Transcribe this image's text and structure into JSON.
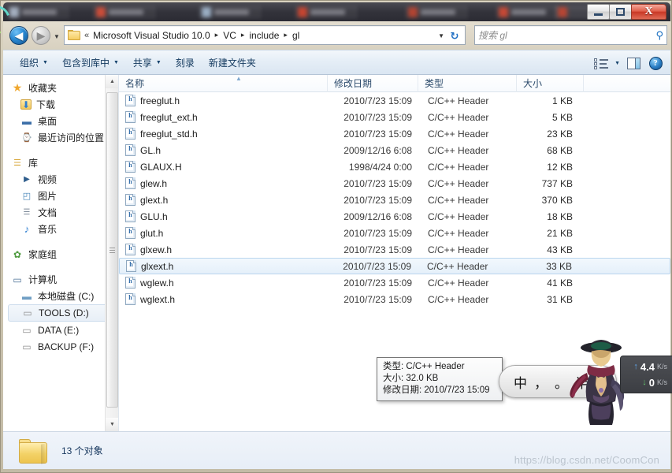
{
  "window": {
    "controls": {
      "minimize": "—",
      "maximize": "□",
      "close": "X"
    },
    "taskbar_chips": 7
  },
  "address": {
    "back_glyph": "◀",
    "forward_glyph": "▶",
    "history_caret": "▼",
    "chevrons": "«",
    "crumbs": [
      "Microsoft Visual Studio 10.0",
      "VC",
      "include",
      "gl"
    ],
    "separator": "▸",
    "dropdown_caret": "▼",
    "refresh_glyph": "↻",
    "search_placeholder": "搜索 gl",
    "search_icon_glyph": "⚲"
  },
  "toolbar": {
    "items": [
      {
        "label": "组织",
        "caret": true
      },
      {
        "label": "包含到库中",
        "caret": true
      },
      {
        "label": "共享",
        "caret": true
      },
      {
        "label": "刻录",
        "caret": false
      },
      {
        "label": "新建文件夹",
        "caret": false
      }
    ],
    "view_caret": "▼",
    "help_glyph": "?"
  },
  "sidebar": {
    "groups": [
      {
        "header": {
          "label": "收藏夹",
          "icon": "star-icon"
        },
        "items": [
          {
            "label": "下载",
            "icon": "downloads-icon"
          },
          {
            "label": "桌面",
            "icon": "desktop-icon"
          },
          {
            "label": "最近访问的位置",
            "icon": "recent-places-icon"
          }
        ]
      },
      {
        "header": {
          "label": "库",
          "icon": "library-icon"
        },
        "items": [
          {
            "label": "视频",
            "icon": "videos-icon"
          },
          {
            "label": "图片",
            "icon": "pictures-icon"
          },
          {
            "label": "文档",
            "icon": "documents-icon"
          },
          {
            "label": "音乐",
            "icon": "music-icon"
          }
        ]
      },
      {
        "header": {
          "label": "家庭组",
          "icon": "homegroup-icon"
        },
        "items": []
      },
      {
        "header": {
          "label": "计算机",
          "icon": "computer-icon"
        },
        "items": [
          {
            "label": "本地磁盘 (C:)",
            "icon": "system-drive-icon",
            "selected": false
          },
          {
            "label": "TOOLS (D:)",
            "icon": "drive-icon",
            "selected": true
          },
          {
            "label": "DATA (E:)",
            "icon": "drive-icon",
            "selected": false
          },
          {
            "label": "BACKUP (F:)",
            "icon": "drive-icon",
            "selected": false
          }
        ]
      }
    ],
    "scroll_up_glyph": "▲",
    "scroll_down_glyph": "▼"
  },
  "filelist": {
    "columns": [
      "名称",
      "修改日期",
      "类型",
      "大小"
    ],
    "sort_indicator": "▲",
    "rows": [
      {
        "name": "freeglut.h",
        "date": "2010/7/23 15:09",
        "type": "C/C++ Header",
        "size": "1 KB",
        "selected": false
      },
      {
        "name": "freeglut_ext.h",
        "date": "2010/7/23 15:09",
        "type": "C/C++ Header",
        "size": "5 KB",
        "selected": false
      },
      {
        "name": "freeglut_std.h",
        "date": "2010/7/23 15:09",
        "type": "C/C++ Header",
        "size": "23 KB",
        "selected": false
      },
      {
        "name": "GL.h",
        "date": "2009/12/16 6:08",
        "type": "C/C++ Header",
        "size": "68 KB",
        "selected": false
      },
      {
        "name": "GLAUX.H",
        "date": "1998/4/24 0:00",
        "type": "C/C++ Header",
        "size": "12 KB",
        "selected": false
      },
      {
        "name": "glew.h",
        "date": "2010/7/23 15:09",
        "type": "C/C++ Header",
        "size": "737 KB",
        "selected": false
      },
      {
        "name": "glext.h",
        "date": "2010/7/23 15:09",
        "type": "C/C++ Header",
        "size": "370 KB",
        "selected": false
      },
      {
        "name": "GLU.h",
        "date": "2009/12/16 6:08",
        "type": "C/C++ Header",
        "size": "18 KB",
        "selected": false
      },
      {
        "name": "glut.h",
        "date": "2010/7/23 15:09",
        "type": "C/C++ Header",
        "size": "21 KB",
        "selected": false
      },
      {
        "name": "glxew.h",
        "date": "2010/7/23 15:09",
        "type": "C/C++ Header",
        "size": "43 KB",
        "selected": false
      },
      {
        "name": "glxext.h",
        "date": "2010/7/23 15:09",
        "type": "C/C++ Header",
        "size": "33 KB",
        "selected": true
      },
      {
        "name": "wglew.h",
        "date": "2010/7/23 15:09",
        "type": "C/C++ Header",
        "size": "41 KB",
        "selected": false
      },
      {
        "name": "wglext.h",
        "date": "2010/7/23 15:09",
        "type": "C/C++ Header",
        "size": "31 KB",
        "selected": false
      }
    ]
  },
  "tooltip": {
    "type_line": "类型: C/C++ Header",
    "size_line": "大小: 32.0 KB",
    "date_line": "修改日期: 2010/7/23 15:09"
  },
  "statusbar": {
    "text": "13 个对象"
  },
  "watermark": {
    "text": "https://blog.csdn.net/CoomCon"
  },
  "ime": {
    "mode_chinese": "中",
    "punct_half": "，",
    "punct_full": "。",
    "width_half": "半"
  },
  "netmonitor": {
    "upload_value": "4.4",
    "upload_unit": "K/s",
    "upload_arrow": "↑",
    "download_value": "0",
    "download_unit": "K/s",
    "download_arrow": "↓"
  },
  "colors": {
    "selection_blue": "#e5f0fa",
    "selection_border": "#b9d5ee",
    "crumb_text": "#1c1c1c",
    "toolbar_text": "#12385e",
    "close_red": "#c93826"
  }
}
